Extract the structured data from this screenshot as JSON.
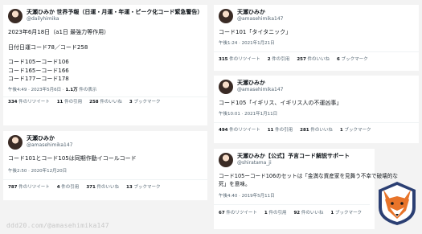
{
  "tweets": [
    {
      "name": "天瀬ひみか 世界予報（日運・月運・年運・ピーク化コード緊急警告）",
      "handle": "@dailyhimika",
      "lines": [
        "2023年6月18日（a1日 最強力等作用）",
        "",
        "日付日運コード78／コード258",
        "",
        "コード105ーコード106",
        "コード165ーコード166",
        "コード177ーコード178"
      ],
      "time": "午後4:49 · 2023年5月6日 · ",
      "views": "1.1万",
      "views_suffix": " 件の表示",
      "retweets": "334",
      "retweets_label": " 件のリツイート",
      "quotes": "11",
      "quotes_label": " 件の引用",
      "likes": "258",
      "likes_label": " 件のいいね",
      "bookmarks": "3",
      "bookmarks_label": " ブックマーク"
    },
    {
      "name": "天瀬ひみか",
      "handle": "@amasehimika147",
      "lines": [
        "コード101とコード105は同期作動イコールコード"
      ],
      "time": "午後2:50 · 2020年12月20日",
      "retweets": "787",
      "retweets_label": " 件のリツイート",
      "quotes": "4",
      "quotes_label": " 件の引用",
      "likes": "371",
      "likes_label": " 件のいいね",
      "bookmarks": "13",
      "bookmarks_label": " ブックマーク"
    },
    {
      "name": "天瀬ひみか",
      "handle": "@amasehimika147",
      "lines": [
        "コード101「タイタニック」"
      ],
      "time": "午後1:24 · 2021年1月21日",
      "retweets": "315",
      "retweets_label": " 件のリツイート",
      "quotes": "2",
      "quotes_label": " 件の引用",
      "likes": "257",
      "likes_label": " 件のいいね",
      "bookmarks": "6",
      "bookmarks_label": " ブックマーク"
    },
    {
      "name": "天瀬ひみか",
      "handle": "@amasehimika147",
      "lines": [
        "コード105「イギリス、イギリス人の不運凶事」"
      ],
      "time": "午後10:01 · 2021年1月11日",
      "retweets": "494",
      "retweets_label": " 件のリツイート",
      "quotes": "11",
      "quotes_label": " 件の引用",
      "likes": "281",
      "likes_label": " 件のいいね",
      "bookmarks": "1",
      "bookmarks_label": " ブックマーク"
    },
    {
      "name": "天瀬ひみか【公式】予言コード解説サポート",
      "handle": "@shiratama_ji",
      "lines": [
        "コード105ーコード106のセットは「金満な資産家を見舞う不幸で破壊的な",
        "死」を意味。"
      ],
      "time": "午後4:40 · 2019年5月11日",
      "retweets": "67",
      "retweets_label": " 件のリツイート",
      "quotes": "1",
      "quotes_label": " 件の引用",
      "likes": "92",
      "likes_label": " 件のいいね",
      "bookmarks": "1",
      "bookmarks_label": " ブックマーク"
    }
  ],
  "watermark": "ddd20.com/@amasehimika147",
  "colors": {
    "text": "#0f1419",
    "muted": "#536471",
    "background": "#f3f3f3",
    "card": "#ffffff",
    "logo_orange": "#e8742a",
    "logo_ring": "#2b3f73"
  },
  "icons": {
    "logo": "fox-logo-icon",
    "avatar": "avatar"
  }
}
